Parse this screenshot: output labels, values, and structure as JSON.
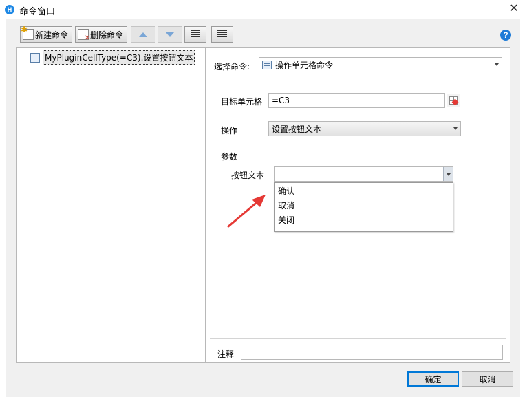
{
  "window": {
    "app_logo_text": "H",
    "title": "命令窗口",
    "close_glyph": "✕"
  },
  "toolbar": {
    "new_label": "新建命令",
    "delete_label": "删除命令"
  },
  "help": {
    "glyph": "?"
  },
  "tree": {
    "items": [
      {
        "label": "MyPluginCellType(=C3).设置按钮文本"
      }
    ]
  },
  "form": {
    "select_command_label": "选择命令:",
    "select_command_value": "操作单元格命令",
    "target_cell_label": "目标单元格",
    "target_cell_value": "=C3",
    "operation_label": "操作",
    "operation_value": "设置按钮文本",
    "params_label": "参数",
    "button_text_label": "按钮文本",
    "button_text_value": "",
    "button_text_options": [
      "确认",
      "取消",
      "关闭"
    ],
    "note_label": "注释",
    "note_value": ""
  },
  "footer": {
    "ok_label": "确定",
    "cancel_label": "取消"
  },
  "colors": {
    "annotation_arrow": "#e53935",
    "accent": "#0078d7"
  }
}
